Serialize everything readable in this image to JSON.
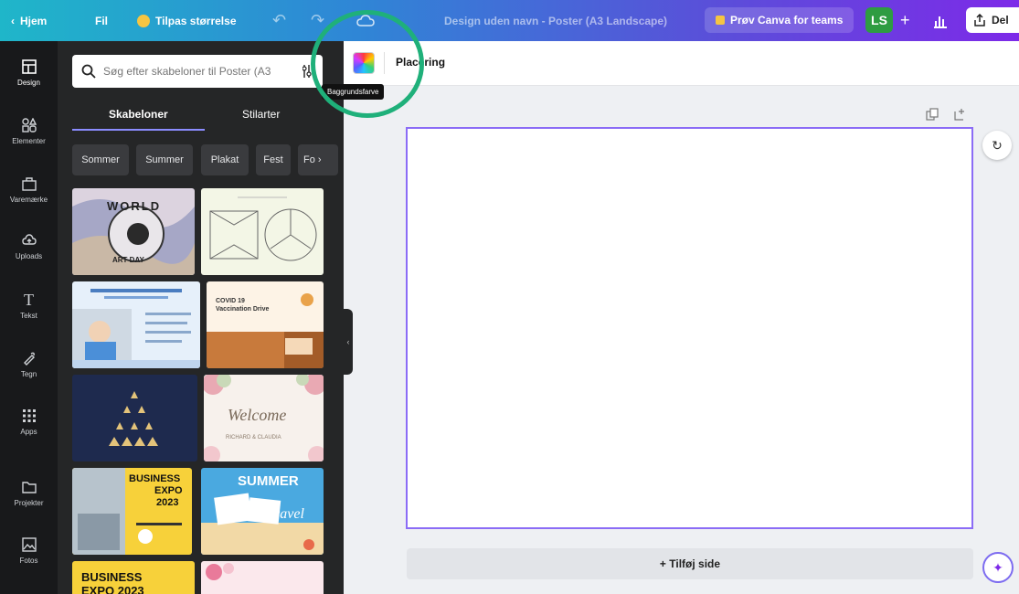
{
  "topbar": {
    "home": "Hjem",
    "file": "Fil",
    "resize": "Tilpas størrelse",
    "doc_title": "Design uden navn - Poster (A3 Landscape)",
    "teams": "Prøv Canva for teams",
    "avatar": "LS",
    "plus": "+",
    "share": "Del"
  },
  "rail": {
    "items": [
      {
        "label": "Design",
        "icon": "layout-icon"
      },
      {
        "label": "Elementer",
        "icon": "shapes-icon"
      },
      {
        "label": "Varemærke",
        "icon": "brand-icon"
      },
      {
        "label": "Uploads",
        "icon": "upload-icon"
      },
      {
        "label": "Tekst",
        "icon": "text-icon"
      },
      {
        "label": "Tegn",
        "icon": "draw-icon"
      },
      {
        "label": "Apps",
        "icon": "apps-icon"
      },
      {
        "label": "Projekter",
        "icon": "folder-icon"
      },
      {
        "label": "Fotos",
        "icon": "photo-icon"
      }
    ]
  },
  "panel": {
    "search_placeholder": "Søg efter skabeloner til Poster (A3",
    "tabs": [
      "Skabeloner",
      "Stilarter"
    ],
    "chips": [
      "Sommer",
      "Summer",
      "Plakat",
      "Fest",
      "Fo"
    ],
    "templates": [
      {
        "name": "World Art Day",
        "line1": "WORLD",
        "line2": "ART DAY",
        "bg": "#dcd3df"
      },
      {
        "name": "Envelope diagram",
        "bg": "#f3f6e6"
      },
      {
        "name": "Medical info",
        "bg": "#e6f0fa"
      },
      {
        "name": "Covid vaccination",
        "line1": "COVID 19",
        "line2": "Vaccination Drive",
        "bg": "#fdf3e6"
      },
      {
        "name": "Dark triangles",
        "bg": "#1e2a4e"
      },
      {
        "name": "Welcome floral",
        "line1": "Welcome",
        "line2": "RICHARD & CLAUDIA",
        "bg": "#f7f1ec"
      },
      {
        "name": "Business Expo",
        "line1": "BUSINESS",
        "line2": "EXPO",
        "line3": "2023",
        "bg": "#f7d13a"
      },
      {
        "name": "Summer Travel",
        "line1": "SUMMER",
        "line2": "Travel",
        "bg": "#4aa9e0"
      },
      {
        "name": "Business Expo 2",
        "line1": "BUSINESS",
        "line2": "EXPO 2023",
        "bg": "#f7d13a"
      },
      {
        "name": "Pink floral",
        "bg": "#fbe8ec"
      }
    ]
  },
  "ctx": {
    "placering": "Placering",
    "tooltip": "Baggrundsfarve"
  },
  "canvas": {
    "add_page": "+ Tilføj side"
  },
  "colors": {
    "accent": "#7d2ae8",
    "highlight": "#1fb07a",
    "page_border": "#8b6cf6"
  }
}
